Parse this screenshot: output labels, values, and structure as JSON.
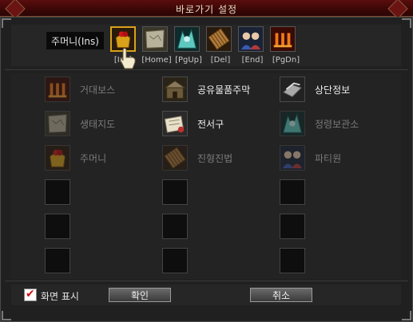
{
  "window": {
    "title": "바로가기 설정"
  },
  "hotkeys": {
    "selected_label": "주머니(Ins)",
    "slots": [
      {
        "key": "[Ins]",
        "icon": "pouch-icon"
      },
      {
        "key": "[Home]",
        "icon": "ecology-map-icon"
      },
      {
        "key": "[PgUp]",
        "icon": "spirit-storage-icon"
      },
      {
        "key": "[Del]",
        "icon": "formation-icon"
      },
      {
        "key": "[End]",
        "icon": "party-icon"
      },
      {
        "key": "[PgDn]",
        "icon": "boss-icon"
      }
    ]
  },
  "items": [
    {
      "label": "거대보스",
      "icon": "boss-icon",
      "enabled": false
    },
    {
      "label": "공유물품주막",
      "icon": "shared-tavern-icon",
      "enabled": true
    },
    {
      "label": "상단정보",
      "icon": "merchant-info-icon",
      "enabled": true
    },
    {
      "label": "생태지도",
      "icon": "ecology-map-icon",
      "enabled": false
    },
    {
      "label": "전서구",
      "icon": "messenger-icon",
      "enabled": true
    },
    {
      "label": "정령보관소",
      "icon": "spirit-storage-icon",
      "enabled": false
    },
    {
      "label": "주머니",
      "icon": "pouch-icon",
      "enabled": false
    },
    {
      "label": "진형진법",
      "icon": "formation-icon",
      "enabled": false
    },
    {
      "label": "파티원",
      "icon": "party-icon",
      "enabled": false
    }
  ],
  "footer": {
    "show_on_screen_label": "화면 표시",
    "show_on_screen_checked": true,
    "confirm_label": "확인",
    "cancel_label": "취소"
  }
}
